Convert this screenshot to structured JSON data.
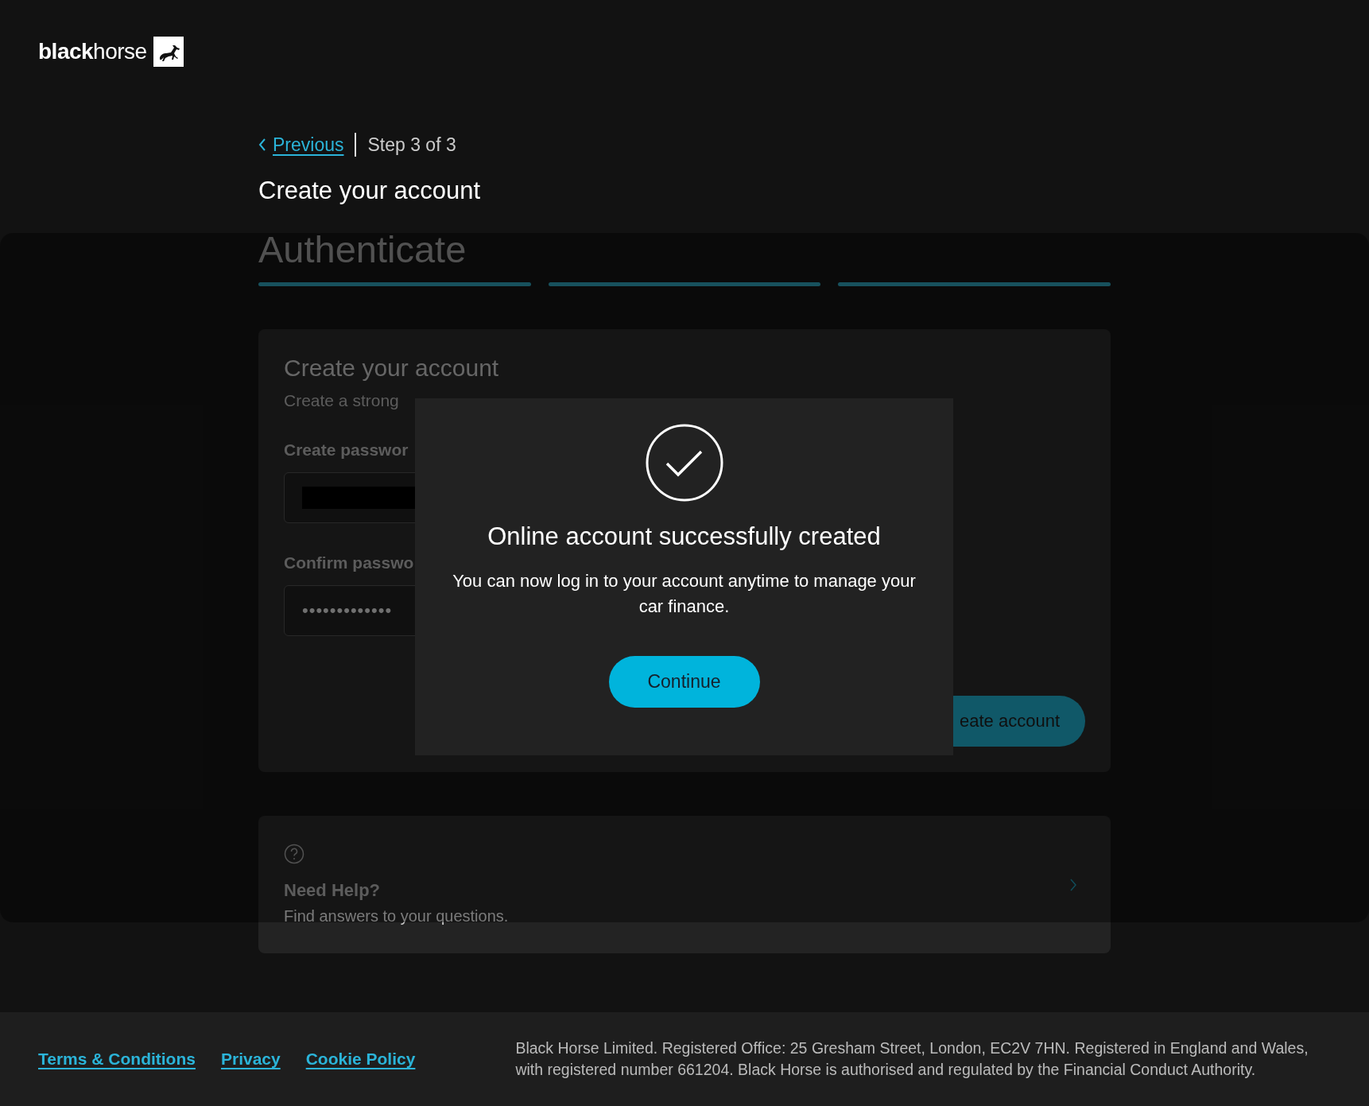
{
  "header": {
    "logo": "**black**horse"
  },
  "nav": {
    "back_link": "Previous",
    "step": "Step 3 of 3"
  },
  "page_title": "Create your account",
  "section_title": "Authenticate",
  "progress_steps": [
    {
      "completed": true
    },
    {
      "completed": true
    },
    {
      "completed": true
    }
  ],
  "form_card": {
    "title": "Create your account",
    "subtitle": "Create a strong",
    "fields": [
      {
        "label": "Create passwor",
        "kind": "redacted"
      },
      {
        "label": "Confirm passwo",
        "kind": "masked",
        "value": "•••••••••••••"
      }
    ],
    "submit_button": "eate account"
  },
  "help_card": {
    "title": "Need Help?",
    "text": "Find answers to your questions."
  },
  "modal": {
    "title": "Online account successfully created",
    "message": "You can now log in to your account anytime to manage your car finance.",
    "button": "Continue"
  },
  "footer": {
    "links": [
      "Terms & Conditions",
      "Privacy",
      "Cookie Policy"
    ],
    "legal_lines": [
      "Black Horse Limited. Registered Office: 25 Gresham Street, London, EC2V 7HN. Registered in England and Wales,",
      "with registered number 661204. Black Horse is authorised and regulated by the Financial Conduct Authority."
    ]
  }
}
